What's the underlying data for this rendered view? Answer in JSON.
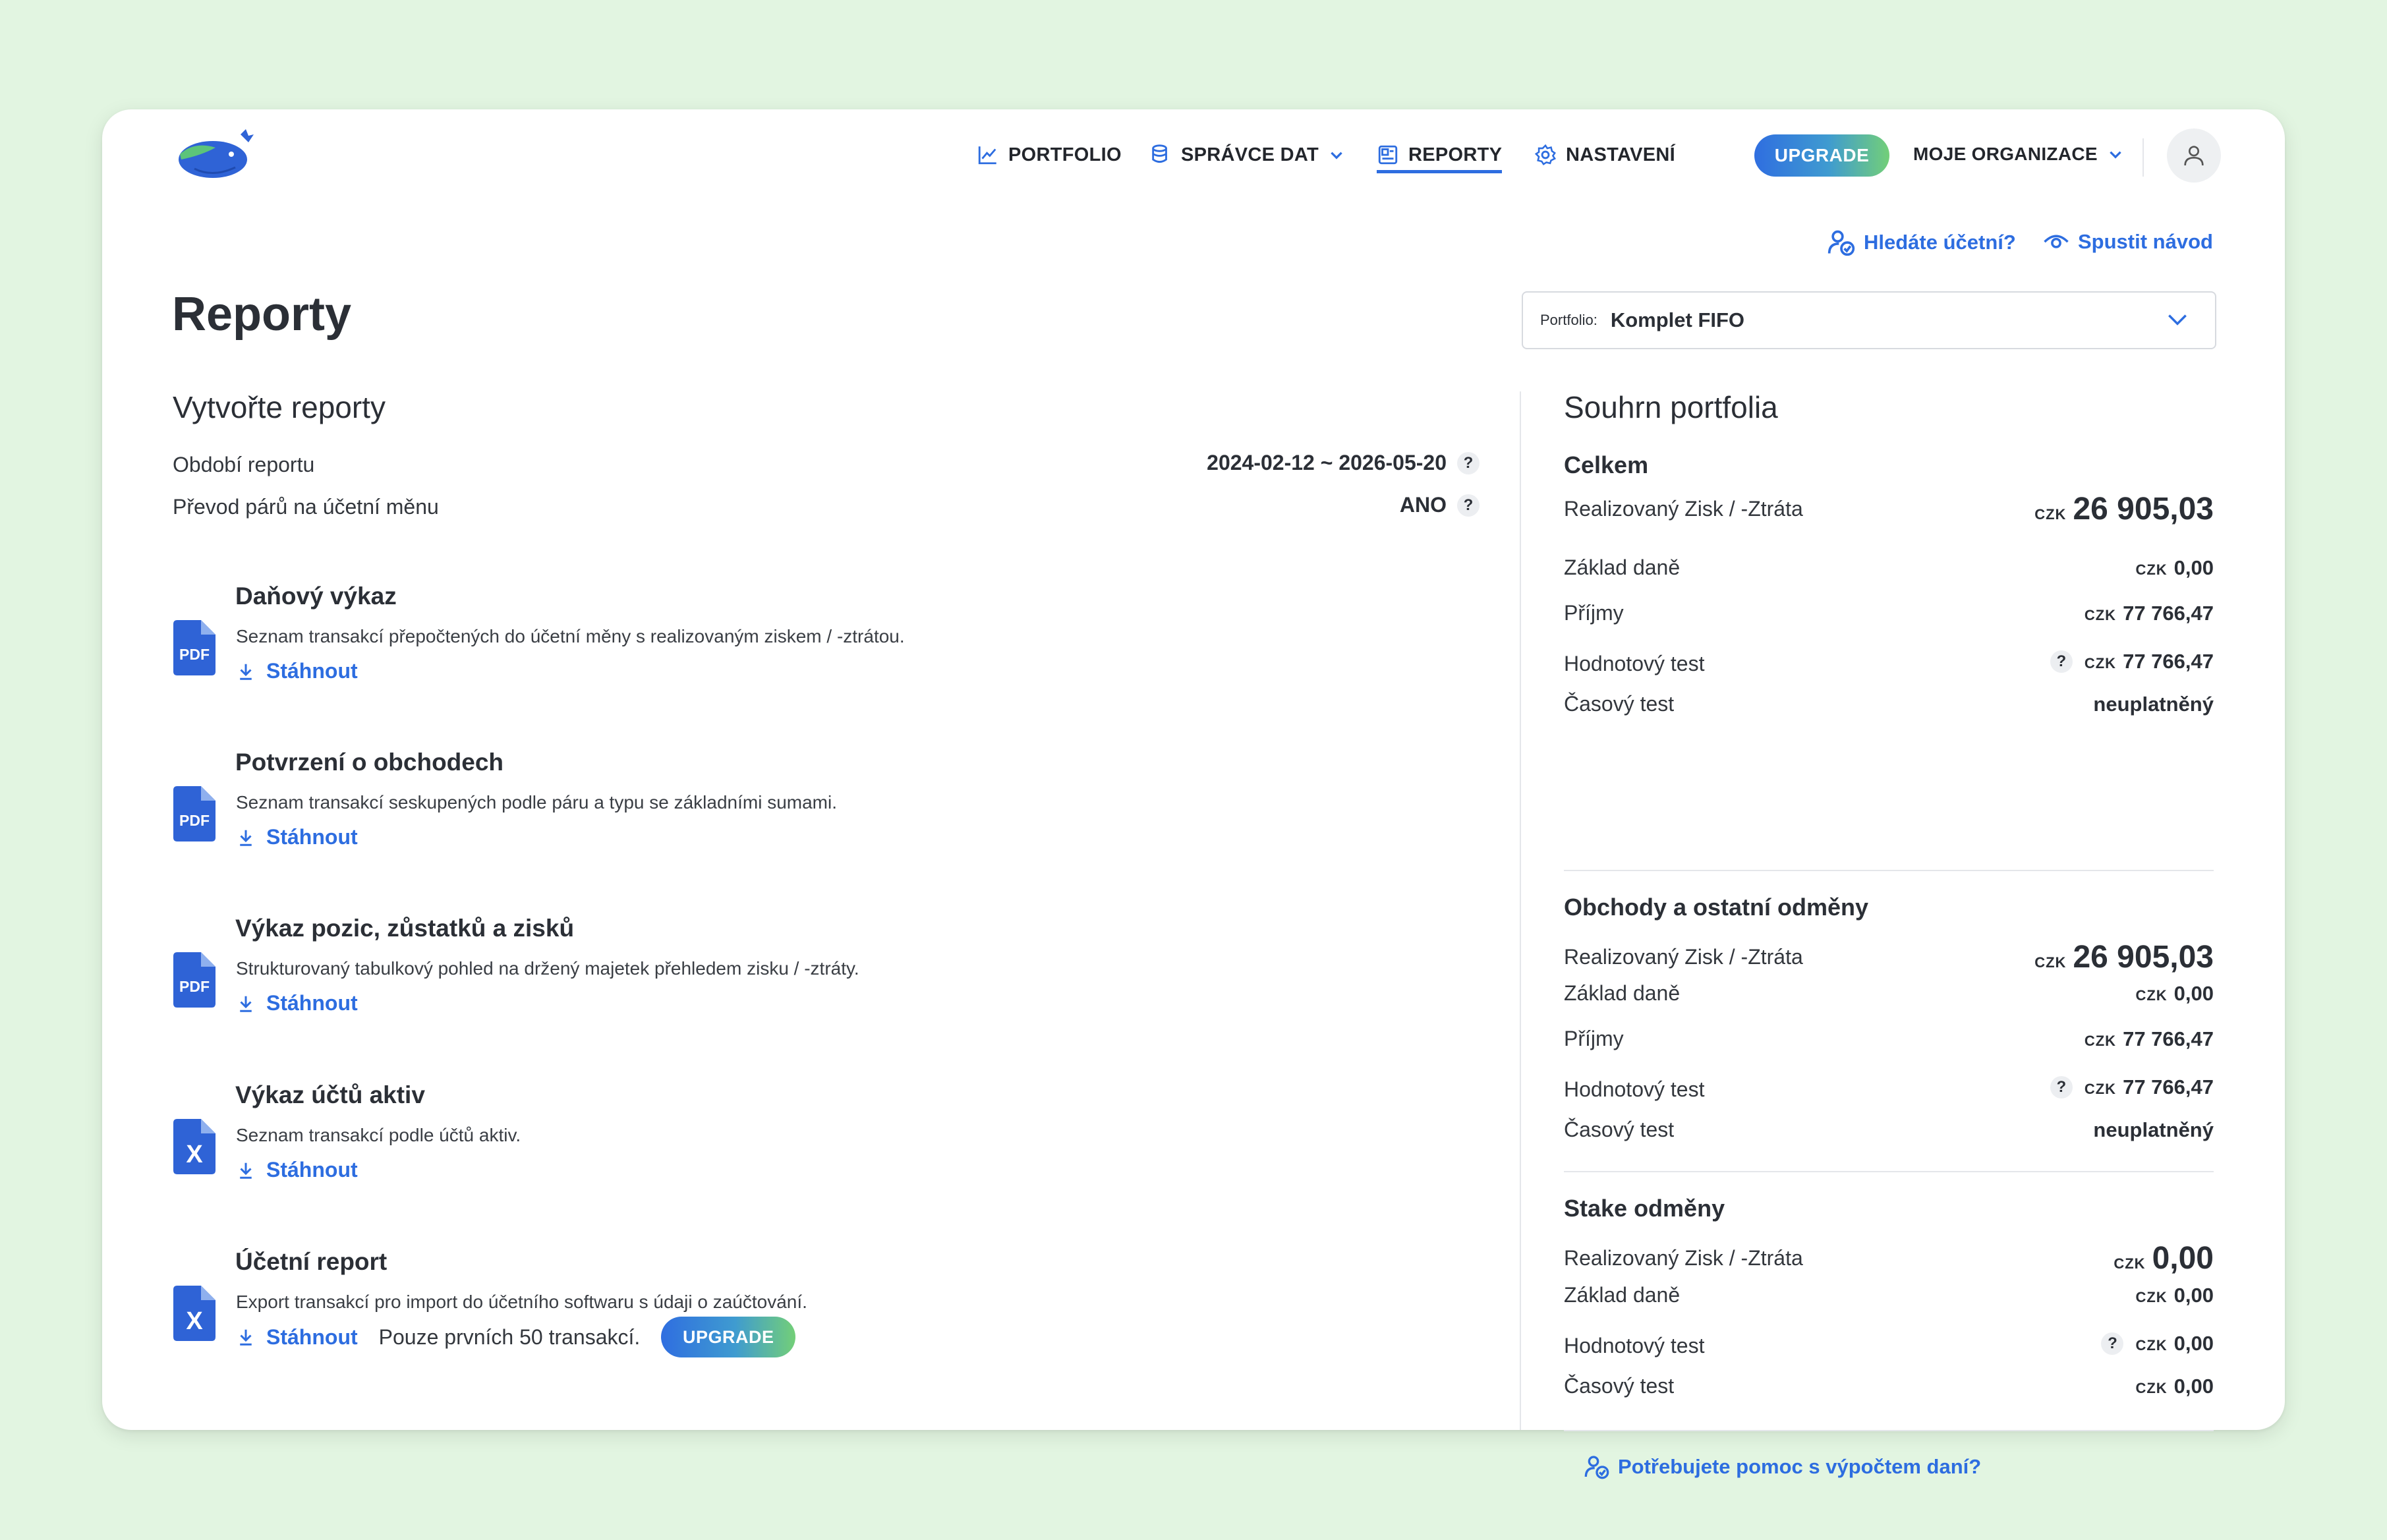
{
  "nav": {
    "portfolio": "PORTFOLIO",
    "data_manager": "SPRÁVCE DAT",
    "reports": "REPORTY",
    "settings": "NASTAVENÍ",
    "upgrade": "UPGRADE",
    "organization": "MOJE ORGANIZACE"
  },
  "links": {
    "find_accountant": "Hledáte účetní?",
    "start_tutorial": "Spustit návod",
    "tax_help": "Potřebujete pomoc s výpočtem daní?"
  },
  "page": {
    "title": "Reporty"
  },
  "portfolio_select": {
    "label": "Portfolio:",
    "value": "Komplet FIFO"
  },
  "create": {
    "heading": "Vytvořte reporty",
    "period_label": "Období reportu",
    "period_value": "2024-02-12 ~ 2026-05-20",
    "conversion_label": "Převod párů na účetní měnu",
    "conversion_value": "ANO",
    "help_glyph": "?"
  },
  "reports": [
    {
      "title": "Daňový výkaz",
      "desc": "Seznam transakcí přepočtených do účetní měny s realizovaným ziskem / -ztrátou.",
      "download": "Stáhnout",
      "icon": "pdf-file-icon",
      "badge": "PDF"
    },
    {
      "title": "Potvrzení o obchodech",
      "desc": "Seznam transakcí seskupených podle páru a typu se základními sumami.",
      "download": "Stáhnout",
      "icon": "pdf-file-icon",
      "badge": "PDF"
    },
    {
      "title": "Výkaz pozic, zůstatků a zisků",
      "desc": "Strukturovaný tabulkový pohled na držený majetek přehledem zisku / -ztráty.",
      "download": "Stáhnout",
      "icon": "pdf-file-icon",
      "badge": "PDF"
    },
    {
      "title": "Výkaz účtů aktiv",
      "desc": "Seznam transakcí podle účtů aktiv.",
      "download": "Stáhnout",
      "icon": "excel-file-icon",
      "badge": "X"
    },
    {
      "title": "Účetní report",
      "desc": "Export transakcí pro import do účetního softwaru s údaji o zaúčtování.",
      "download": "Stáhnout",
      "icon": "excel-file-icon",
      "badge": "X",
      "note": "Pouze prvních 50 transakcí.",
      "upgrade": "UPGRADE"
    }
  ],
  "summary": {
    "heading": "Souhrn portfolia",
    "currency": "CZK",
    "total": {
      "title": "Celkem",
      "realized_label": "Realizovaný Zisk / -Ztráta",
      "realized": "26 905,03",
      "tax_base_label": "Základ daně",
      "tax_base": "0,00",
      "income_label": "Příjmy",
      "income": "77 766,47",
      "value_test_label": "Hodnotový test",
      "value_test": "77 766,47",
      "time_test_label": "Časový test",
      "time_test": "neuplatněný"
    },
    "trades": {
      "title": "Obchody a ostatní odměny",
      "realized_label": "Realizovaný Zisk / -Ztráta",
      "realized": "26 905,03",
      "tax_base_label": "Základ daně",
      "tax_base": "0,00",
      "income_label": "Příjmy",
      "income": "77 766,47",
      "value_test_label": "Hodnotový test",
      "value_test": "77 766,47",
      "time_test_label": "Časový test",
      "time_test": "neuplatněný"
    },
    "stake": {
      "title": "Stake odměny",
      "realized_label": "Realizovaný Zisk / -Ztráta",
      "realized": "0,00",
      "tax_base_label": "Základ daně",
      "tax_base": "0,00",
      "value_test_label": "Hodnotový test",
      "value_test": "0,00",
      "time_test_label": "Časový test",
      "time_test": "0,00"
    }
  },
  "colors": {
    "accent": "#2d6de0",
    "background": "#e2f5e1",
    "upgrade_gradient_start": "#2f6ee0",
    "upgrade_gradient_end": "#73cf78"
  }
}
